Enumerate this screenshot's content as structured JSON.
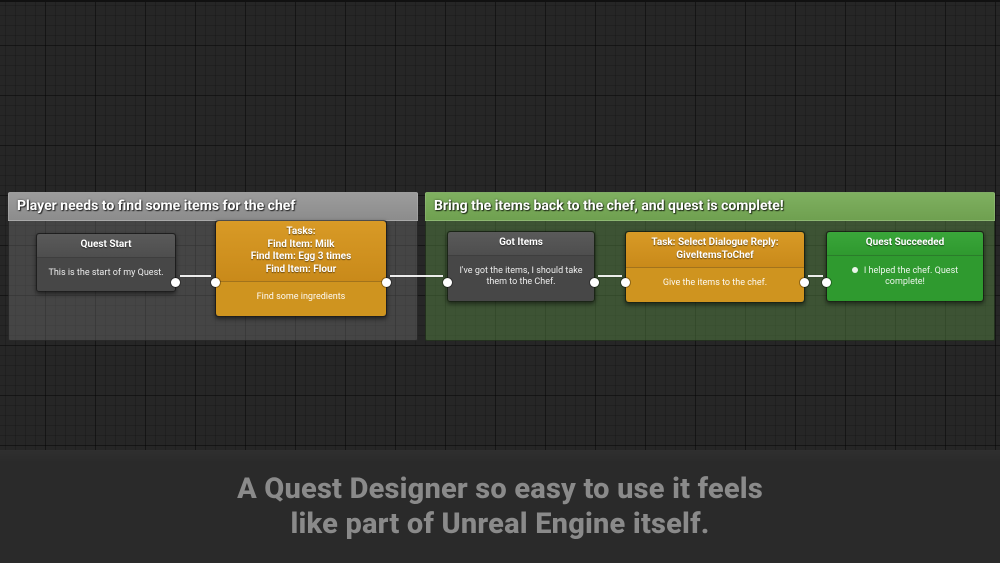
{
  "caption": "A Quest Designer so easy to use it feels\nlike part of Unreal Engine itself.",
  "groups": {
    "left": {
      "title": "Player needs to find some items for the chef"
    },
    "right": {
      "title": "Bring the items back to the chef, and quest is complete!"
    }
  },
  "nodes": {
    "start": {
      "title": "Quest Start",
      "body": "This is the start of my Quest."
    },
    "tasks": {
      "title": "Tasks:\nFind Item: Milk\nFind Item: Egg 3 times\nFind Item: Flour",
      "body": "Find some ingredients"
    },
    "gotItems": {
      "title": "Got Items",
      "body": "I've got the items, I should take them to the Chef."
    },
    "dialogue": {
      "title": "Task: Select Dialogue Reply: GiveItemsToChef",
      "body": "Give the items to the chef."
    },
    "succeeded": {
      "title": "Quest Succeeded",
      "body": "I helped the chef. Quest complete!"
    }
  }
}
